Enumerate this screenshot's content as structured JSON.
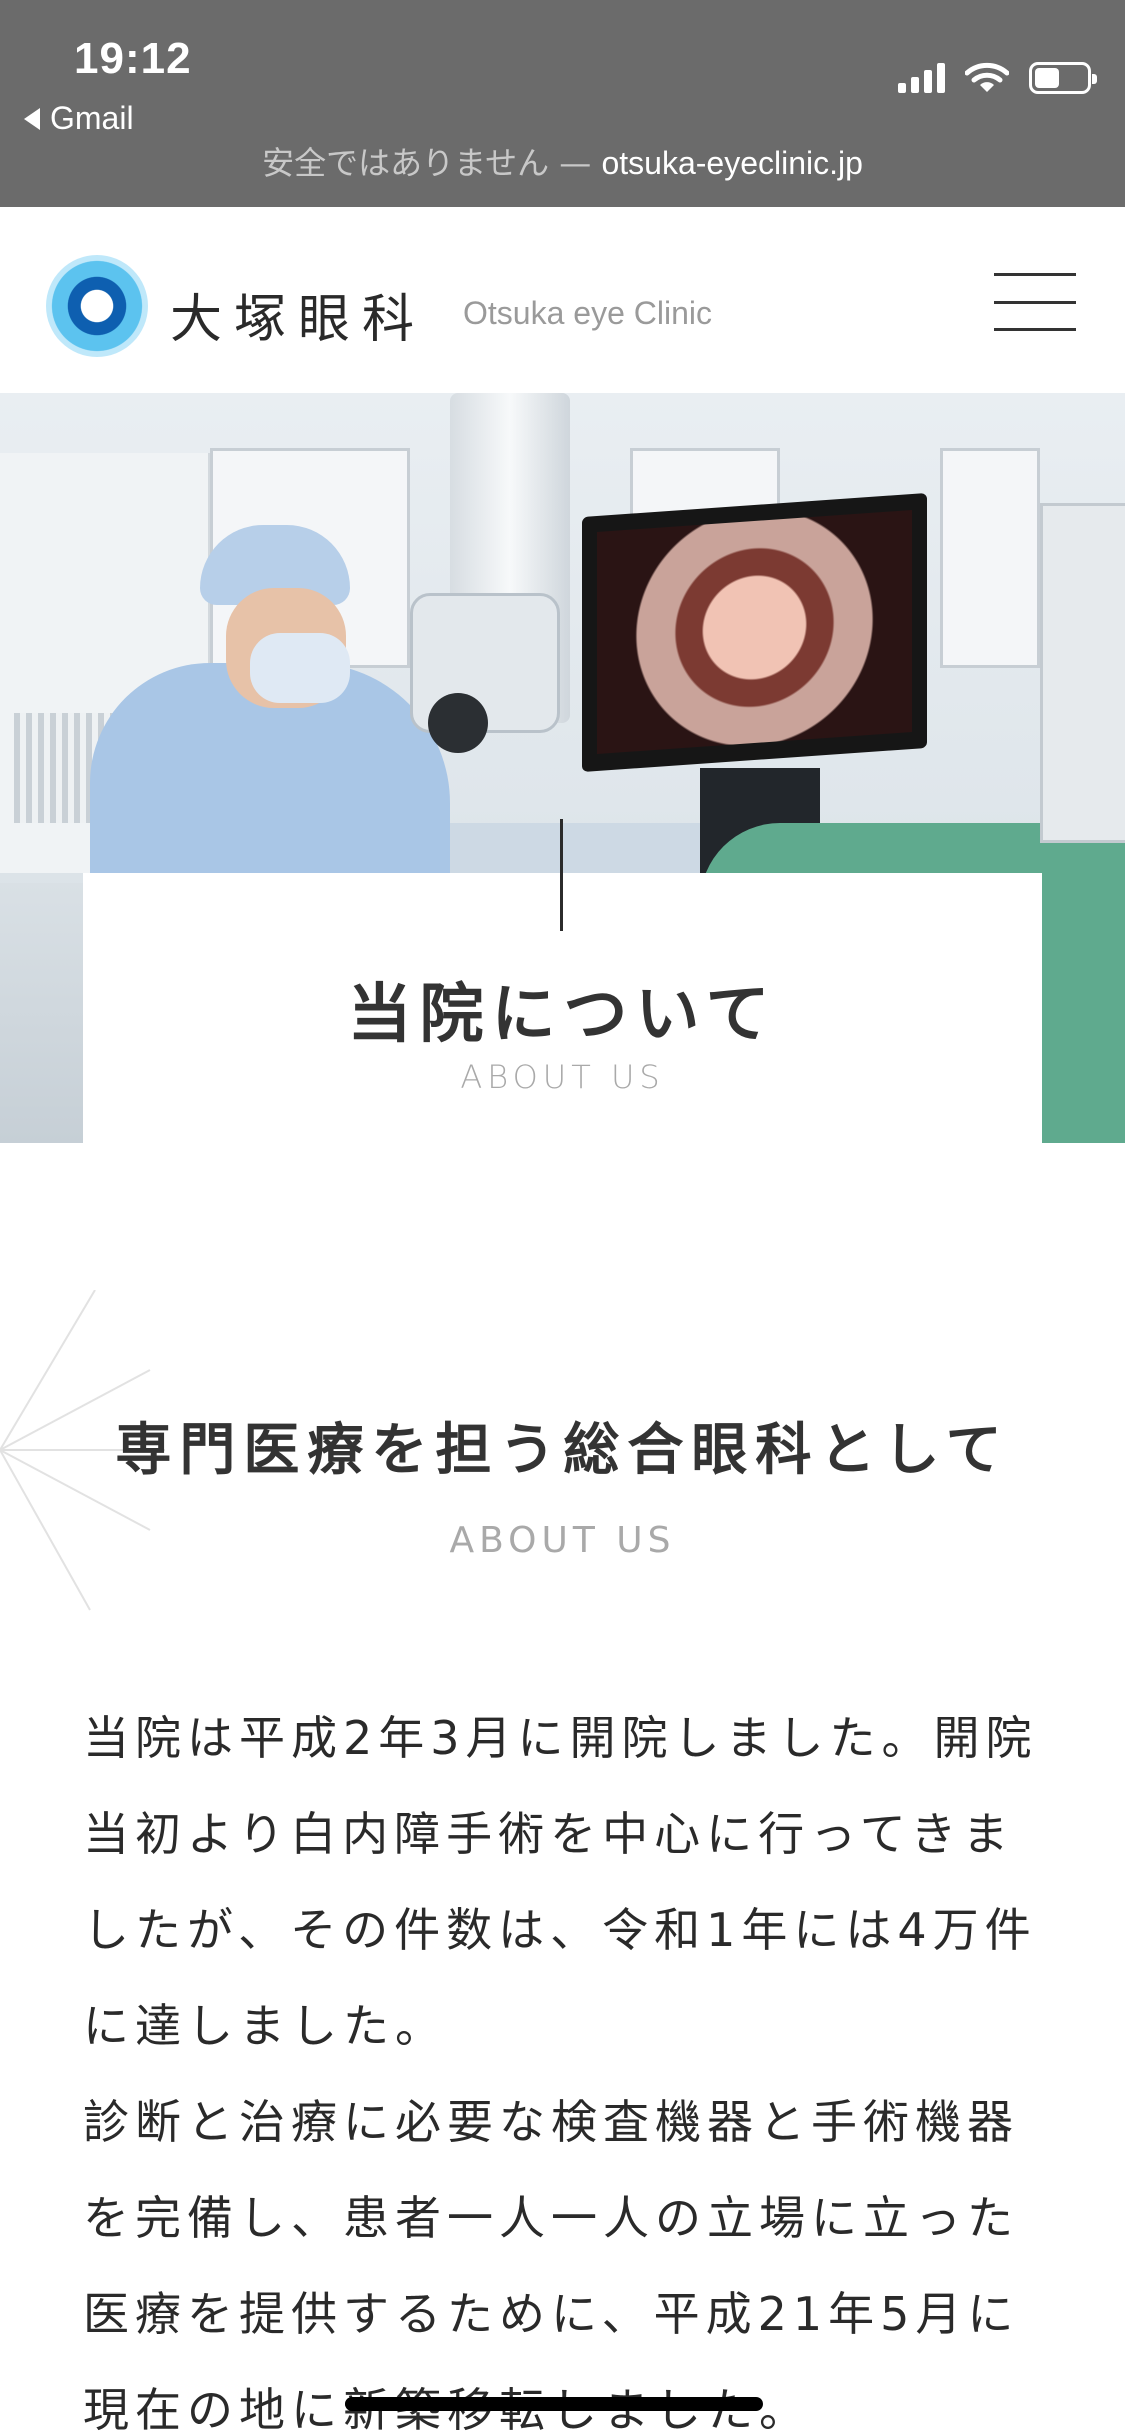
{
  "status_bar": {
    "time": "19:12",
    "back_app": "Gmail",
    "insecure_label": "安全ではありません —",
    "domain": "otsuka-eyeclinic.jp"
  },
  "header": {
    "logo_jp": "大塚眼科",
    "logo_en": "Otsuka eye Clinic"
  },
  "hero": {
    "title": "当院について",
    "subtitle": "ABOUT US"
  },
  "section": {
    "heading": "専門医療を担う総合眼科として",
    "subheading": "ABOUT US",
    "paragraph1": "当院は平成2年3月に開院しました。開院当初より白内障手術を中心に行ってきましたが、その件数は、令和1年には4万件に達しました。",
    "paragraph2": "診断と治療に必要な検査機器と手術機器を完備し、患者一人一人の立場に立った医療を提供するために、平成21年5月に現在の地に新築移転しました。"
  },
  "colors": {
    "status_bar_bg": "#6b6b6b",
    "logo_blue": "#0e5fb0",
    "text": "#2a2a2a",
    "muted": "#a9a9a9"
  },
  "icons": [
    "back-arrow-icon",
    "signal-icon",
    "wifi-icon",
    "battery-icon",
    "logo-eye-icon",
    "hamburger-menu-icon"
  ]
}
